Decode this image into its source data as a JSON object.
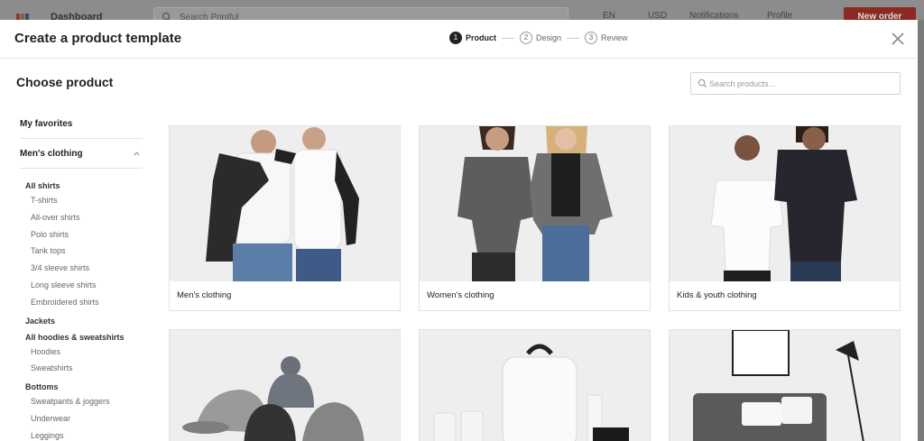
{
  "app_bar": {
    "title": "Dashboard",
    "search_placeholder": "Search Printful",
    "language": "EN",
    "currency": "USD",
    "notifications": "Notifications",
    "user": "Profile",
    "cta": "New order"
  },
  "modal": {
    "title": "Create a product template",
    "steps": [
      {
        "num": "1",
        "label": "Product",
        "active": true
      },
      {
        "num": "2",
        "label": "Design",
        "active": false
      },
      {
        "num": "3",
        "label": "Review",
        "active": false
      }
    ],
    "close_icon": "close-icon"
  },
  "main": {
    "section_title": "Choose product",
    "search_placeholder": "Search products..."
  },
  "sidebar": {
    "favorites": "My favorites",
    "category": "Men's clothing",
    "groups": [
      {
        "title": "All shirts",
        "items": [
          "T-shirts",
          "All-over shirts",
          "Polo shirts",
          "Tank tops",
          "3/4 sleeve shirts",
          "Long sleeve shirts",
          "Embroidered shirts"
        ]
      },
      {
        "title": "Jackets",
        "items": []
      },
      {
        "title": "All hoodies & sweatshirts",
        "items": [
          "Hoodies",
          "Sweatshirts"
        ]
      },
      {
        "title": "Bottoms",
        "items": [
          "Sweatpants & joggers",
          "Underwear",
          "Leggings"
        ]
      }
    ]
  },
  "products": [
    {
      "label": "Men's clothing"
    },
    {
      "label": "Women's clothing"
    },
    {
      "label": "Kids & youth clothing"
    },
    {
      "label": ""
    },
    {
      "label": ""
    },
    {
      "label": ""
    }
  ],
  "colors": {
    "accent": "#e02b20",
    "active_step": "#222222",
    "card_bg": "#eeeeee"
  }
}
